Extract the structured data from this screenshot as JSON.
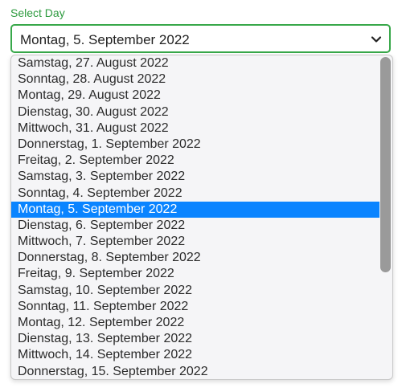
{
  "field": {
    "label": "Select Day",
    "selected_value": "Montag, 5. September 2022"
  },
  "icons": {
    "dropdown": "chevron-down-icon"
  },
  "colors": {
    "label": "#2e9b3f",
    "border": "#38a84a",
    "highlight": "#0a84ff"
  },
  "options": [
    "Samstag, 27. August 2022",
    "Sonntag, 28. August 2022",
    "Montag, 29. August 2022",
    "Dienstag, 30. August 2022",
    "Mittwoch, 31. August 2022",
    "Donnerstag, 1. September 2022",
    "Freitag, 2. September 2022",
    "Samstag, 3. September 2022",
    "Sonntag, 4. September 2022",
    "Montag, 5. September 2022",
    "Dienstag, 6. September 2022",
    "Mittwoch, 7. September 2022",
    "Donnerstag, 8. September 2022",
    "Freitag, 9. September 2022",
    "Samstag, 10. September 2022",
    "Sonntag, 11. September 2022",
    "Montag, 12. September 2022",
    "Dienstag, 13. September 2022",
    "Mittwoch, 14. September 2022",
    "Donnerstag, 15. September 2022"
  ],
  "selected_index": 9
}
